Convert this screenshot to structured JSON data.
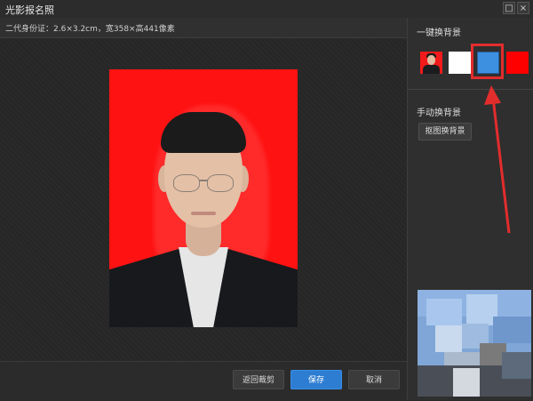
{
  "window": {
    "title": "光影报名照",
    "max_glyph": "□",
    "close_glyph": "×"
  },
  "info": {
    "spec": "二代身份证：2.6×3.2cm，宽358×高441像素"
  },
  "right_panel": {
    "one_key_title": "一键换背景",
    "manual_title": "手动换背景",
    "cutout_button": "抠图换背景",
    "swatches": [
      {
        "name": "original",
        "color": "#f21a1a"
      },
      {
        "name": "white",
        "color": "#ffffff"
      },
      {
        "name": "blue",
        "color": "#3d8fe0",
        "selected": true
      },
      {
        "name": "red",
        "color": "#ff0000"
      }
    ]
  },
  "footer": {
    "back_label": "返回裁剪",
    "save_label": "保存",
    "cancel_label": "取消"
  },
  "colors": {
    "accent": "#2d7dd2",
    "highlight": "#e22d2d",
    "photo_background": "#ff1212"
  }
}
